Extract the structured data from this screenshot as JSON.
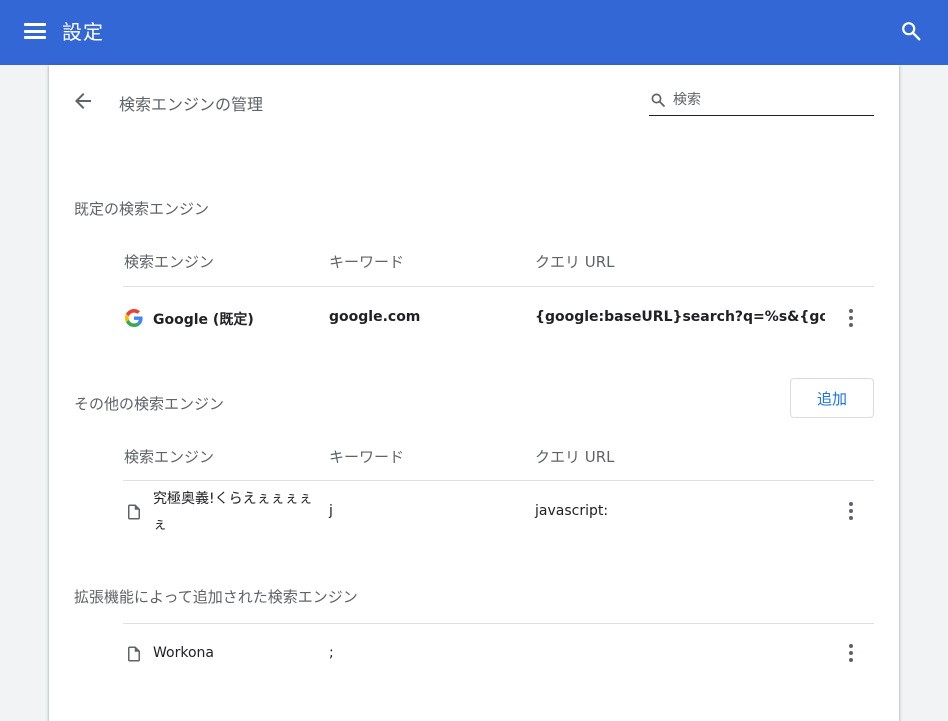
{
  "header": {
    "title": "設定"
  },
  "page": {
    "title": "検索エンジンの管理",
    "search_placeholder": "検索"
  },
  "default_section": {
    "title": "既定の検索エンジン",
    "columns": {
      "engine": "検索エンジン",
      "keyword": "キーワード",
      "url": "クエリ URL"
    },
    "rows": [
      {
        "name": "Google (既定)",
        "keyword": "google.com",
        "url": "{google:baseURL}search?q=%s&{go…",
        "icon": "google-icon"
      }
    ]
  },
  "other_section": {
    "title": "その他の検索エンジン",
    "add_label": "追加",
    "columns": {
      "engine": "検索エンジン",
      "keyword": "キーワード",
      "url": "クエリ URL"
    },
    "rows": [
      {
        "name_line1": "究極奥義!くらえぇぇぇぇ",
        "name_line2": "ぇ",
        "keyword": "j",
        "url": "javascript:",
        "icon": "file-icon"
      }
    ]
  },
  "extension_section": {
    "title": "拡張機能によって追加された検索エンジン",
    "rows": [
      {
        "name": "Workona",
        "keyword": ";",
        "icon": "file-icon"
      }
    ]
  },
  "colors": {
    "header_bg": "#3367d6",
    "accent": "#1a73e8",
    "secondary_text": "#5f6368"
  }
}
